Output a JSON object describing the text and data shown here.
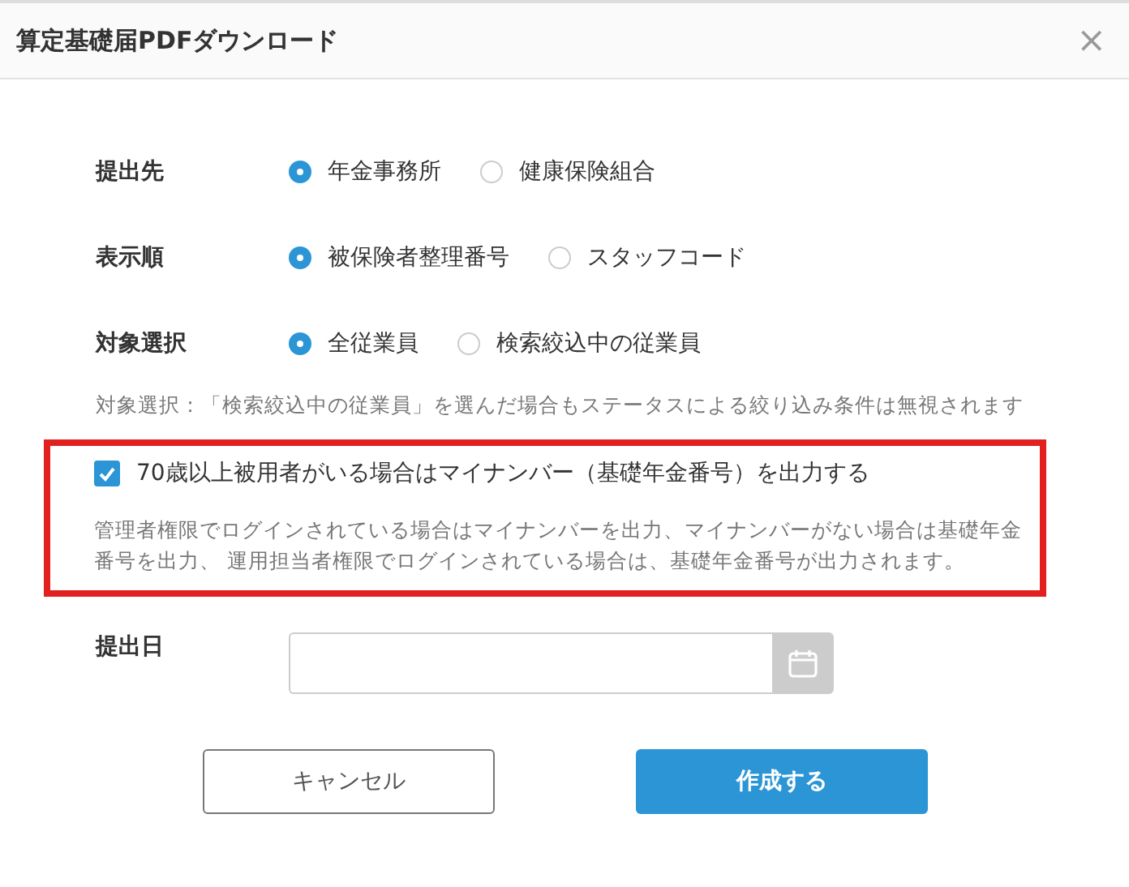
{
  "dialog": {
    "title": "算定基礎届PDFダウンロード",
    "close": "×"
  },
  "radio_groups": [
    {
      "label": "提出先",
      "options": [
        {
          "label": "年金事務所",
          "selected": true
        },
        {
          "label": "健康保険組合",
          "selected": false
        }
      ]
    },
    {
      "label": "表示順",
      "options": [
        {
          "label": "被保険者整理番号",
          "selected": true
        },
        {
          "label": "スタッフコード",
          "selected": false
        }
      ]
    },
    {
      "label": "対象選択",
      "options": [
        {
          "label": "全従業員",
          "selected": true
        },
        {
          "label": "検索絞込中の従業員",
          "selected": false
        }
      ]
    }
  ],
  "note": "対象選択：「検索絞込中の従業員」を選んだ場合もステータスによる絞り込み条件は無視されます",
  "highlight_box": {
    "checkbox": {
      "label": "70歳以上被用者がいる場合はマイナンバー（基礎年金番号）を出力する",
      "checked": true
    },
    "description": "管理者権限でログインされている場合はマイナンバーを出力、マイナンバーがない場合は基礎年金番号を出力、 運用担当者権限でログインされている場合は、基礎年金番号が出力されます。"
  },
  "date_field": {
    "label": "提出日"
  },
  "buttons": [
    {
      "label": "キャンセル",
      "kind": "secondary"
    },
    {
      "label": "作成する",
      "kind": "primary"
    }
  ]
}
